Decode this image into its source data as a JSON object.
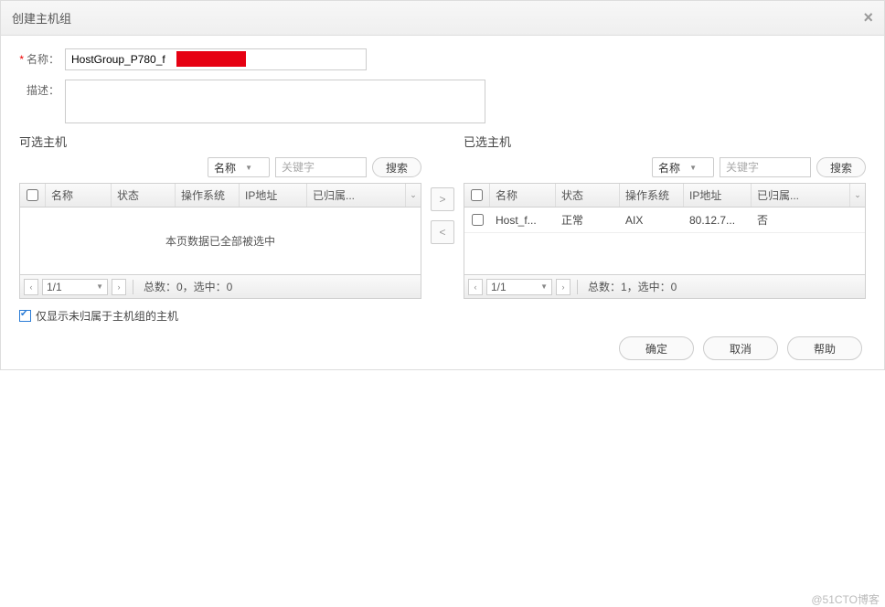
{
  "dialog": {
    "title": "创建主机组",
    "close_label": "×"
  },
  "form": {
    "name_label": "名称：",
    "name_value": "HostGroup_P780_f",
    "desc_label": "描述：",
    "desc_value": ""
  },
  "left": {
    "title": "可选主机",
    "search_field": "名称",
    "keyword_placeholder": "关键字",
    "search_btn": "搜索",
    "columns": {
      "name": "名称",
      "status": "状态",
      "os": "操作系统",
      "ip": "IP地址",
      "grouped": "已归属..."
    },
    "empty_msg": "本页数据已全部被选中",
    "page": "1/1",
    "footer": "总数：0，选中：0"
  },
  "right": {
    "title": "已选主机",
    "search_field": "名称",
    "keyword_placeholder": "关键字",
    "search_btn": "搜索",
    "columns": {
      "name": "名称",
      "status": "状态",
      "os": "操作系统",
      "ip": "IP地址",
      "grouped": "已归属..."
    },
    "rows": [
      {
        "name": "Host_f...",
        "status": "正常",
        "os": "AIX",
        "ip": "80.12.7...",
        "grouped": "否"
      }
    ],
    "page": "1/1",
    "footer": "总数：1，选中：0"
  },
  "filter": {
    "checked": true,
    "label": "仅显示未归属于主机组的主机"
  },
  "buttons": {
    "ok": "确定",
    "cancel": "取消",
    "help": "帮助"
  },
  "watermark": "@51CTO博客"
}
